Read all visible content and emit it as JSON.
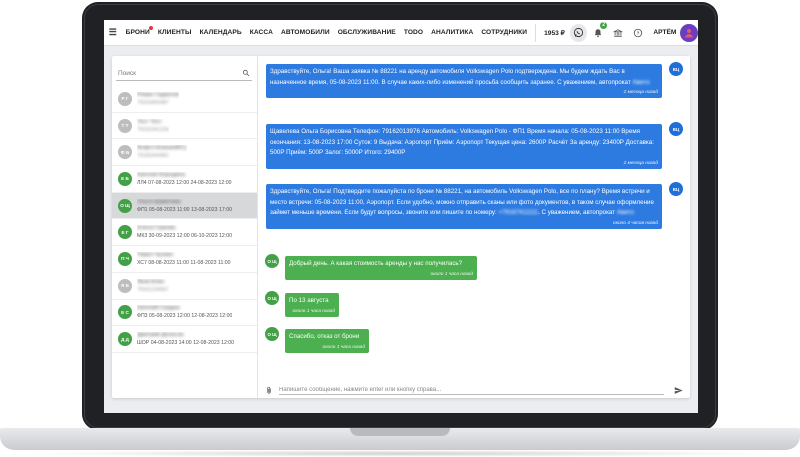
{
  "header": {
    "nav": [
      {
        "label": "БРОНИ",
        "dot": true
      },
      {
        "label": "КЛИЕНТЫ"
      },
      {
        "label": "КАЛЕНДАРЬ"
      },
      {
        "label": "КАССА"
      },
      {
        "label": "АВТОМОБИЛИ"
      },
      {
        "label": "ОБСЛУЖИВАНИЕ"
      },
      {
        "label": "TODO"
      },
      {
        "label": "АНАЛИТИКА"
      },
      {
        "label": "СОТРУДНИКИ"
      }
    ],
    "balance": "1953 ₽",
    "notifications_badge": "2",
    "user_name": "АРТЁМ"
  },
  "sidebar": {
    "search_placeholder": "Поиск",
    "chats": [
      {
        "initials": "Р Г",
        "color": "#bdbdbd",
        "name": "Роман Гадиатов",
        "sub": "79163456487",
        "name_blur": true,
        "sub_blur": true
      },
      {
        "initials": "Т Т",
        "color": "#bdbdbd",
        "name": "Тест Тест",
        "sub": "79162341234",
        "name_blur": true,
        "sub_blur": true
      },
      {
        "initials": "Ф Б",
        "color": "#bdbdbd",
        "name": "Фсфсп Блинкейбту",
        "sub": "79166344981",
        "name_blur": true,
        "sub_blur": true
      },
      {
        "initials": "Е Б",
        "color": "#43a047",
        "name": "Евгения Бородина",
        "sub": "ЛЛ4 07-08-2023 12:00 24-08-2023 12:00",
        "name_blur": true,
        "sub_blur": false
      },
      {
        "initials": "О Щ",
        "color": "#43a047",
        "name": "Ольга Щавелева",
        "sub": "ФП1 05-08-2023 11:00 13-08-2023 17:00",
        "name_blur": true,
        "sub_blur": false,
        "selected": true
      },
      {
        "initials": "Е Г",
        "color": "#43a047",
        "name": "Елена Горкова",
        "sub": "МК3 30-09-2023 12:00 06-10-2023 12:00",
        "name_blur": true,
        "sub_blur": false
      },
      {
        "initials": "П Ч",
        "color": "#43a047",
        "name": "Павел Чулкин",
        "sub": "ХС7 08-08-2023 11:00 11-08-2023 11:00",
        "name_blur": true,
        "sub_blur": false
      },
      {
        "initials": "Я Б",
        "color": "#bdbdbd",
        "name": "Яков Блин",
        "sub": "79161234567",
        "name_blur": true,
        "sub_blur": true
      },
      {
        "initials": "Е С",
        "color": "#43a047",
        "name": "Евгений Сердюк",
        "sub": "ФП3 05-08-2023 12:00 12-08-2023 12:00",
        "name_blur": true,
        "sub_blur": false
      },
      {
        "initials": "Д Д",
        "color": "#43a047",
        "name": "Дмитрий Денисов",
        "sub": "ШОР 04-08-2023 14:00 12-08-2023 12:00",
        "name_blur": true,
        "sub_blur": false
      }
    ]
  },
  "messages": [
    {
      "dir": "out",
      "text": "Здравствуйте, Ольга! Ваша заявка № 88221 на аренду автомобиля Volkswagen Polo подтверждена. Мы будем ждать Вас в назначенное время, 05-08-2023 11:00. В случае каких-либо изменений просьба сообщить заранее. С уважением, автопрокат",
      "blurred": "Авито",
      "time": "2 месяца назад",
      "avatar": "ВЦ"
    },
    {
      "dir": "out",
      "text": "Щавелева Ольга Борисовна Телефон: 79162013976 Автомобиль: Volkswagen Polo - ФП1 Время начала: 05-08-2023 11:00 Время окончания: 13-08-2023 17:00 Суток: 9 Выдача: Аэропорт Приём: Аэропорт Текущая цена: 2600Р Расчёт За аренду: 23400Р Доставка: 500Р Приём: 500Р Залог: 5000Р Итого: 29400Р",
      "blurred": "",
      "time": "2 месяца назад",
      "avatar": "ВЦ"
    },
    {
      "dir": "out",
      "text": "Здравствуйте, Ольга! Подтвердите пожалуйста по брони № 88221, на автомобиль Volkswagen Polo, все по плану? Время встречи и место встречи: 05-08-2023 11:00, Аэропорт. Если удобно, можно отправить сканы или фото документов, в таком случае оформление займет меньше времени. Если будут вопросы, звоните или пишите по номеру:",
      "blurred": "+79167411111",
      "tail": ". С уважением, автопрокат",
      "blurred2": "Авито",
      "time": "около 4 часов назад",
      "avatar": "ВЦ"
    },
    {
      "dir": "in",
      "text": "Добрый день. А какая стоимость аренды у нас получилась?",
      "time": "около 1 часа назад",
      "avatar": "О Щ"
    },
    {
      "dir": "in",
      "text": "По 13 августа",
      "time": "около 1 часа назад",
      "avatar": "О Щ"
    },
    {
      "dir": "in",
      "text": "Спасибо, отказ от брони",
      "time": "около 1 часа назад",
      "avatar": "О Щ"
    }
  ],
  "composer": {
    "placeholder": "Напишите сообщение, нажмите enter или кнопку справа..."
  },
  "colors": {
    "outgoing": "#2d7be0",
    "incoming": "#4caf50",
    "avatar_out": "#1e6fd9",
    "avatar_in": "#43a047"
  }
}
